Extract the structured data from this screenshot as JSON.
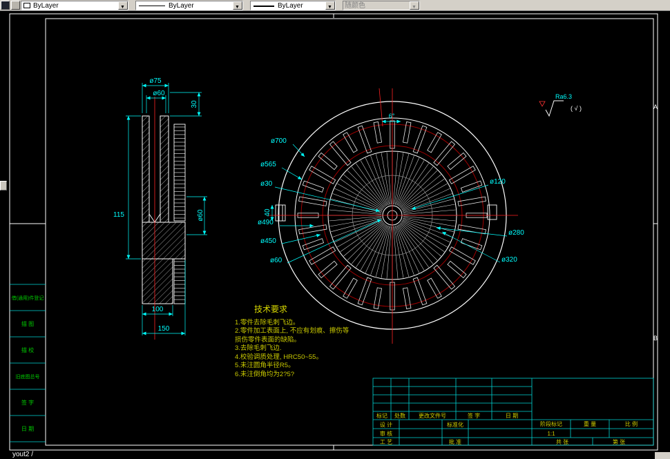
{
  "toolbar": {
    "color": {
      "value": "ByLayer"
    },
    "linetype": {
      "value": "ByLayer"
    },
    "lineweight": {
      "value": "ByLayer"
    },
    "plot_style": {
      "value": "随颜色"
    }
  },
  "status": {
    "text": "yout2 /"
  },
  "frame": {
    "zone_a": "A",
    "zone_b": "B"
  },
  "left_strip": {
    "items": [
      "借(通用)件登记",
      "描 图",
      "描 校",
      "旧底图总号",
      "签 字",
      "日 期"
    ]
  },
  "surface": {
    "ra": "Ra6.3",
    "paren": "( √ )"
  },
  "section_dims": {
    "d75": "ø75",
    "d60_top": "ø60",
    "h30": "30",
    "len115": "115",
    "d60_right": "ø60",
    "w100": "100",
    "w150": "150"
  },
  "circle_dims": {
    "a6": "6°",
    "d700": "ø700",
    "d565": "ø565",
    "d30": "ø30",
    "h40": "40",
    "d490": "ø490",
    "d450": "ø450",
    "d60": "ø60",
    "d120": "ø120",
    "d280": "ø280",
    "d320": "ø320"
  },
  "tech": {
    "title": "技术要求",
    "lines": [
      "1.零件去除毛刺飞边。",
      "2.零件加工表面上, 不应有划痕、擦伤等",
      "  损伤零件表面的缺陷。",
      "3.去除毛刺飞边.",
      "4.校验调质处理, HRC50~55。",
      "5.未注圆角半径R5。",
      "6.未注倒角均为2?5?"
    ]
  },
  "title_block": {
    "rev_headers": [
      "标记",
      "处数",
      "更改文件号",
      "签 字",
      "日 期"
    ],
    "labels": {
      "design": "设 计",
      "standard": "标准化",
      "audit": "审 核",
      "process": "工 艺",
      "approve": "批 准",
      "stage": "阶段标记",
      "weight": "重 量",
      "scale": "比 例",
      "scale_value": "1:1",
      "sheet_total": "共  张",
      "sheet_no": "第  张"
    }
  },
  "colors": {
    "dim": "#00ffff",
    "centerline": "#ff2222",
    "slot_ring": "#a00000",
    "tech_text": "#c8c800",
    "strip_text": "#00cc00",
    "outline": "#ffffff"
  }
}
